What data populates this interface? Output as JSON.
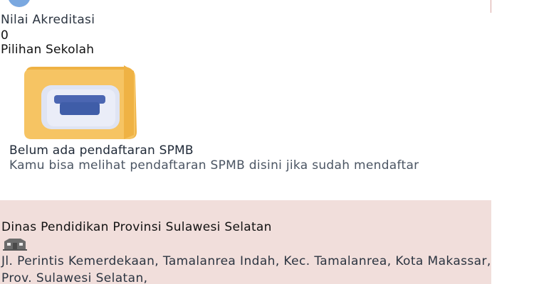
{
  "school": {
    "akreditasi_label": "Nilai Akreditasi",
    "akreditasi_value": "0",
    "pilihan_label": "Pilihan Sekolah"
  },
  "empty_state": {
    "title": "Belum ada pendaftaran SPMB",
    "description": "Kamu bisa melihat pendaftaran SPMB disini jika sudah mendaftar",
    "icon": "folder-box-icon"
  },
  "dinas": {
    "name": "Dinas Pendidikan Provinsi Sulawesi Selatan",
    "icon": "building-icon",
    "address": "Jl. Perintis Kemerdekaan, Tamalanrea Indah, Kec. Tamalanrea, Kota Makassar, Prov. Sulawesi Selatan,"
  },
  "colors": {
    "panel_background": "#f1dedb",
    "folder": "#f6c463",
    "box_accent": "#3f5da8"
  }
}
